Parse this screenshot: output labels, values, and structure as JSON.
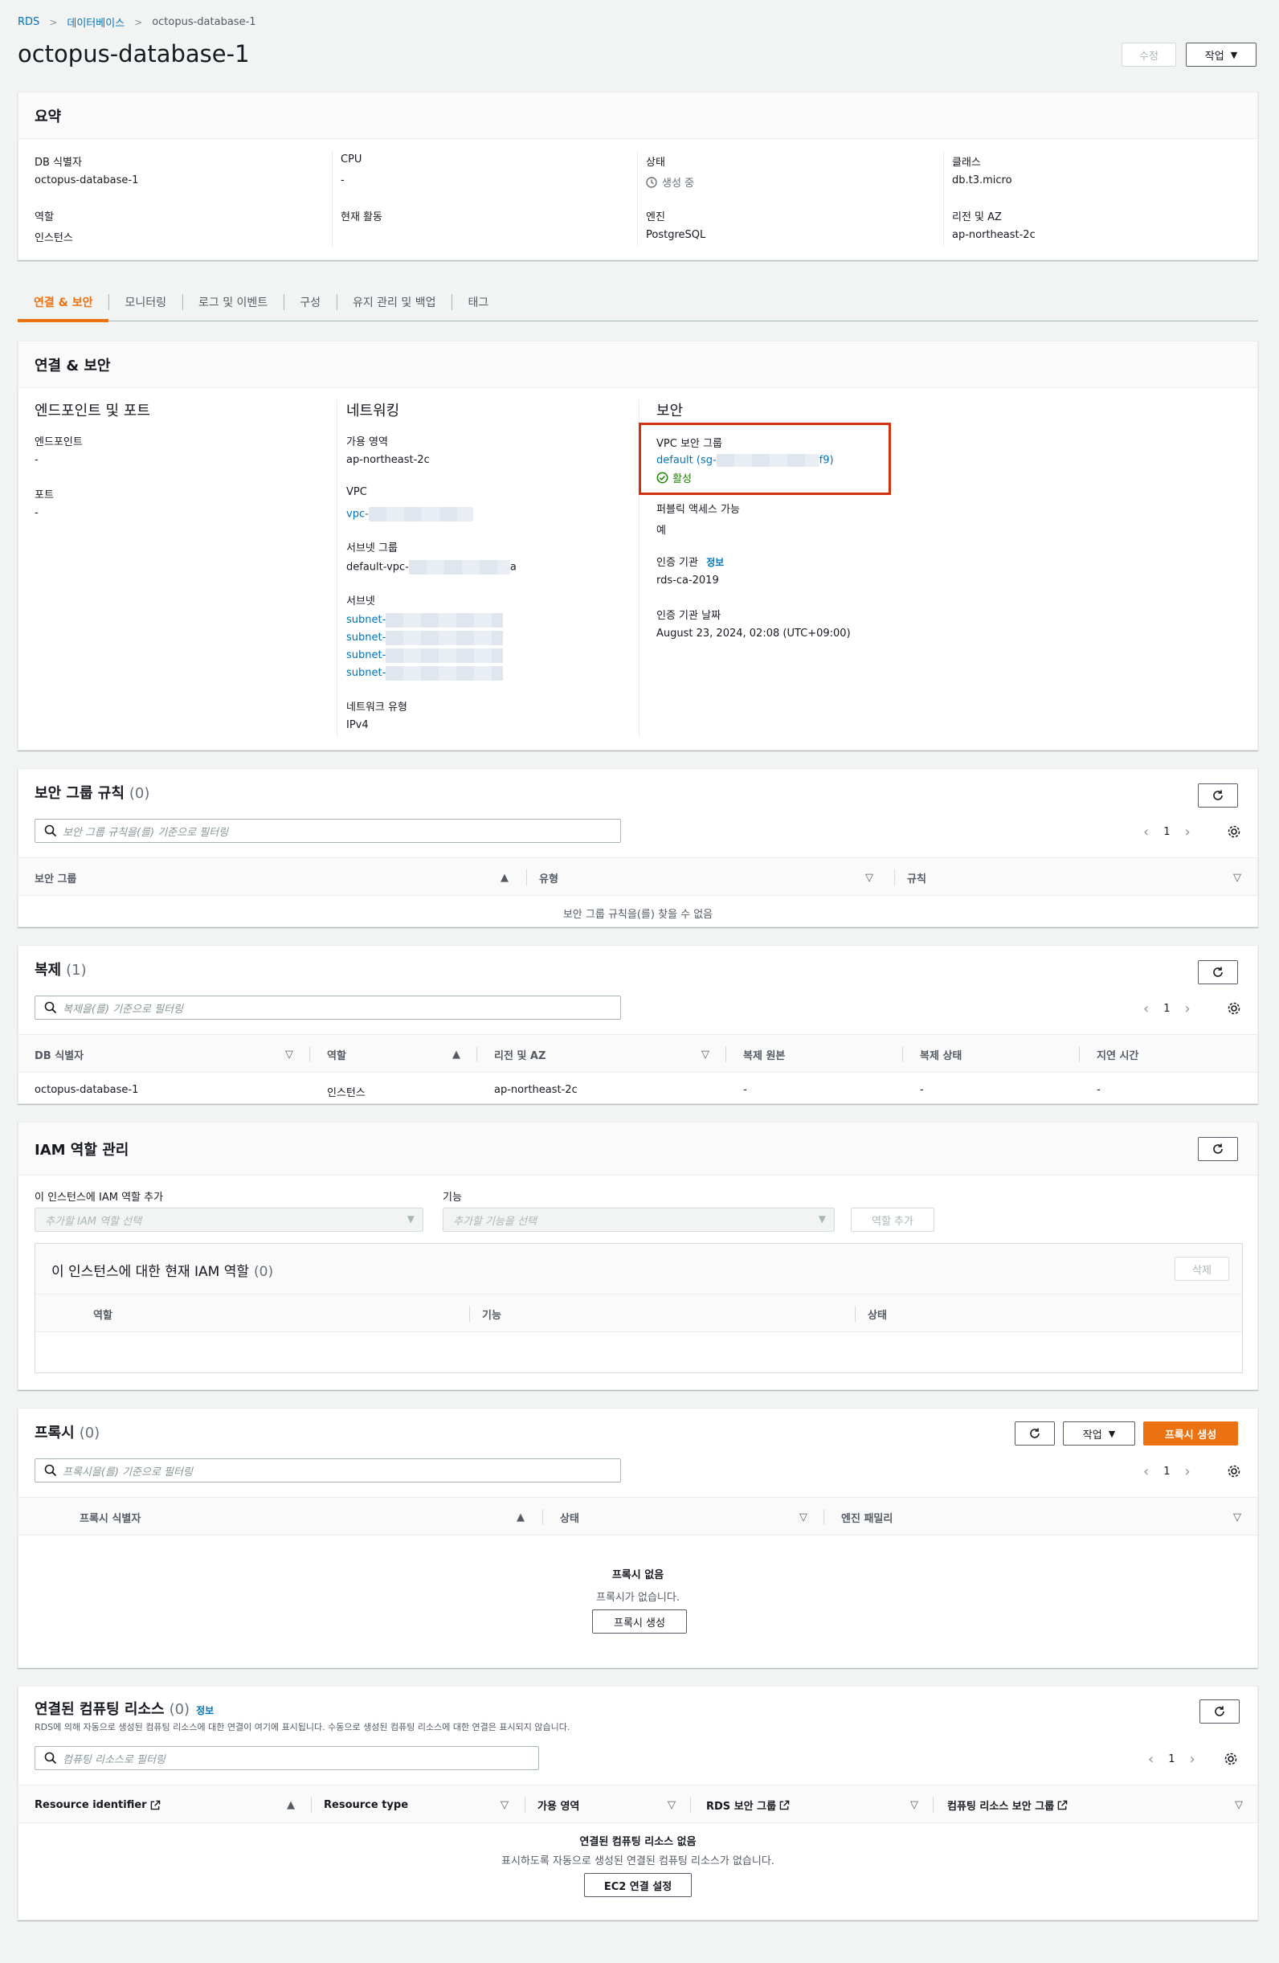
{
  "breadcrumb": {
    "root": "RDS",
    "databases": "데이터베이스",
    "current": "octopus-database-1"
  },
  "page": {
    "title": "octopus-database-1",
    "edit_label": "수정",
    "actions_label": "작업"
  },
  "summary": {
    "title": "요약",
    "fields": [
      {
        "label": "DB 식별자",
        "value": "octopus-database-1"
      },
      {
        "label": "CPU",
        "value": "-"
      },
      {
        "label": "상태",
        "value": "생성 중"
      },
      {
        "label": "클래스",
        "value": "db.t3.micro"
      },
      {
        "label": "역할",
        "value": "인스턴스"
      },
      {
        "label": "현재 활동",
        "value": ""
      },
      {
        "label": "엔진",
        "value": "PostgreSQL"
      },
      {
        "label": "리전 및 AZ",
        "value": "ap-northeast-2c"
      }
    ]
  },
  "tabs": [
    "연결 & 보안",
    "모니터링",
    "로그 및 이벤트",
    "구성",
    "유지 관리 및 백업",
    "태그"
  ],
  "connectivity": {
    "title": "연결 & 보안",
    "endpoint_section": {
      "title": "엔드포인트 및 포트",
      "endpoint_label": "엔드포인트",
      "endpoint_value": "-",
      "port_label": "포트",
      "port_value": "-"
    },
    "networking": {
      "title": "네트워킹",
      "az_label": "가용 영역",
      "az_value": "ap-northeast-2c",
      "vpc_label": "VPC",
      "vpc_value": "vpc-",
      "subnet_group_label": "서브넷 그룹",
      "subnet_group_prefix": "default-vpc-",
      "subnet_group_suffix": "a",
      "subnets_label": "서브넷",
      "subnets": [
        "subnet-",
        "subnet-",
        "subnet-",
        "subnet-"
      ],
      "network_type_label": "네트워크 유형",
      "network_type_value": "IPv4"
    },
    "security": {
      "title": "보안",
      "vpc_sg_label": "VPC 보안 그룹",
      "vpc_sg_prefix": "default (sg-",
      "vpc_sg_suffix": "f9)",
      "vpc_sg_status": "활성",
      "public_label": "퍼블릭 액세스 가능",
      "public_value": "예",
      "ca_label": "인증 기관",
      "ca_info": "정보",
      "ca_value": "rds-ca-2019",
      "ca_date_label": "인증 기관 날짜",
      "ca_date_value": "August 23, 2024, 02:08 (UTC+09:00)"
    }
  },
  "sg_rules": {
    "title": "보안 그룹 규칙",
    "count": "(0)",
    "search_placeholder": "보안 그룹 규칙을(를) 기준으로 필터링",
    "page": "1",
    "columns": [
      "보안 그룹",
      "유형",
      "규칙"
    ],
    "empty": "보안 그룹 규칙을(를) 찾을 수 없음"
  },
  "replication": {
    "title": "복제",
    "count": "(1)",
    "search_placeholder": "복제을(를) 기준으로 필터링",
    "page": "1",
    "columns": [
      "DB 식별자",
      "역할",
      "리전 및 AZ",
      "복제 원본",
      "복제 상태",
      "지연 시간"
    ],
    "rows": [
      [
        "octopus-database-1",
        "인스턴스",
        "ap-northeast-2c",
        "-",
        "-",
        "-"
      ]
    ]
  },
  "iam": {
    "title": "IAM 역할 관리",
    "add_role_label": "이 인스턴스에 IAM 역할 추가",
    "add_role_placeholder": "추가할 IAM 역할 선택",
    "feature_label": "기능",
    "feature_placeholder": "추가할 기능을 선택",
    "add_button": "역할 추가",
    "current_title": "이 인스턴스에 대한 현재 IAM 역할",
    "current_count": "(0)",
    "delete_button": "삭제",
    "columns": [
      "역할",
      "기능",
      "상태"
    ]
  },
  "proxies": {
    "title": "프록시",
    "count": "(0)",
    "actions_label": "작업",
    "create_label": "프록시 생성",
    "search_placeholder": "프록시을(를) 기준으로 필터링",
    "page": "1",
    "columns": [
      "프록시 식별자",
      "상태",
      "엔진 패밀리"
    ],
    "empty_title": "프록시 없음",
    "empty_desc": "프록시가 없습니다.",
    "empty_button": "프록시 생성"
  },
  "compute": {
    "title": "연결된 컴퓨팅 리소스",
    "count": "(0)",
    "info": "정보",
    "description": "RDS에 의해 자동으로 생성된 컴퓨팅 리소스에 대한 연결이 여기에 표시됩니다. 수동으로 생성된 컴퓨팅 리소스에 대한 연결은 표시되지 않습니다.",
    "search_placeholder": "컴퓨팅 리소스로 필터링",
    "page": "1",
    "columns": [
      "Resource identifier",
      "Resource type",
      "가용 영역",
      "RDS 보안 그룹",
      "컴퓨팅 리소스 보안 그룹"
    ],
    "empty_title": "연결된 컴퓨팅 리소스 없음",
    "empty_desc": "표시하도록 자동으로 생성된 연결된 컴퓨팅 리소스가 없습니다.",
    "empty_button": "EC2 연결 설정"
  },
  "colors": {
    "accent": "#ec7211",
    "link": "#0073bb",
    "success": "#1d8102",
    "highlight": "#d13212"
  },
  "icons": [
    "chevron-right-icon",
    "status-pending-icon",
    "check-circle-icon",
    "search-icon",
    "refresh-icon",
    "gear-icon",
    "external-link-icon",
    "sort-icon"
  ]
}
